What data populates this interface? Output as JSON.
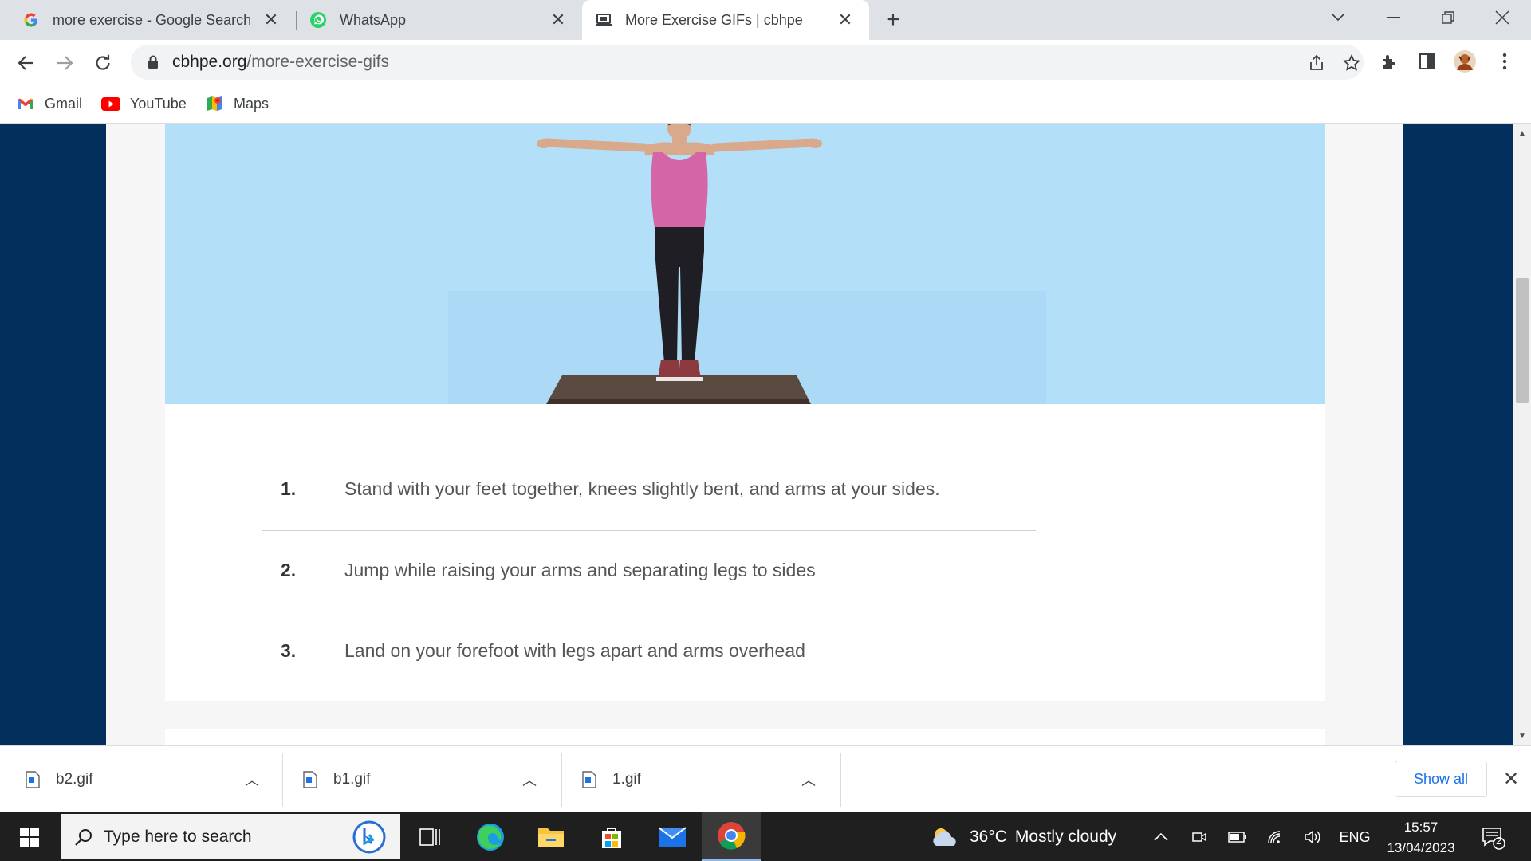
{
  "browser": {
    "tabs": [
      {
        "title": "more exercise - Google Search",
        "icon": "google-icon",
        "active": false
      },
      {
        "title": "WhatsApp",
        "icon": "whatsapp-icon",
        "active": false
      },
      {
        "title": "More Exercise GIFs | cbhpe",
        "icon": "laptop-icon",
        "active": true
      }
    ],
    "new_tab_label": "+",
    "url": {
      "domain": "cbhpe.org",
      "path": "/more-exercise-gifs"
    },
    "bookmarks": [
      {
        "label": "Gmail",
        "icon": "gmail-icon"
      },
      {
        "label": "YouTube",
        "icon": "youtube-icon"
      },
      {
        "label": "Maps",
        "icon": "maps-icon"
      }
    ]
  },
  "page": {
    "gif_subject": "woman doing jumping jacks",
    "steps": [
      {
        "num": "1.",
        "text": "Stand with your feet together, knees slightly bent, and arms at your sides."
      },
      {
        "num": "2.",
        "text": "Jump while raising your arms and separating legs to sides"
      },
      {
        "num": "3.",
        "text": "Land on your forefoot with legs apart and arms overhead"
      }
    ]
  },
  "downloads": {
    "items": [
      {
        "name": "b2.gif"
      },
      {
        "name": "b1.gif"
      },
      {
        "name": "1.gif"
      }
    ],
    "show_all": "Show all"
  },
  "taskbar": {
    "search_placeholder": "Type here to search",
    "weather": {
      "temp": "36°C",
      "condition": "Mostly cloudy"
    },
    "language": "ENG",
    "time": "15:57",
    "date": "13/04/2023",
    "notification_count": "2"
  },
  "colors": {
    "page_background": "#032f5d",
    "gif_sky": "#b3dff9",
    "link_blue": "#1a73e8",
    "taskbar": "#1f1f1f"
  }
}
